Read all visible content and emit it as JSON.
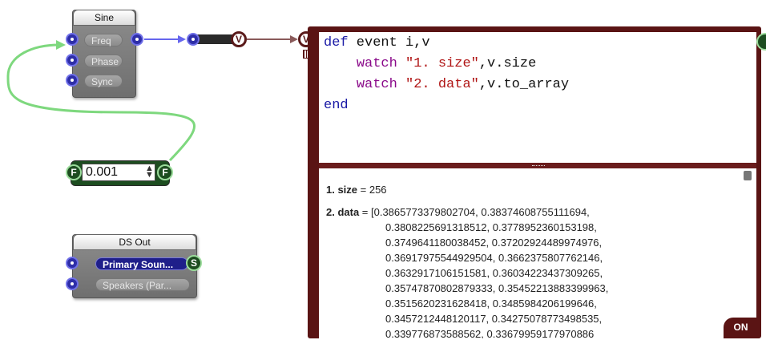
{
  "sine": {
    "title": "Sine",
    "inputs": [
      "Freq",
      "Phase",
      "Sync"
    ]
  },
  "float_box": {
    "value": "0.001",
    "in_port": "F",
    "out_port": "F"
  },
  "ds_out": {
    "title": "DS Out",
    "inputs": [
      "Primary Soun...",
      "Speakers (Par..."
    ],
    "out_port": "S"
  },
  "v_port_label": "V",
  "code": {
    "line1_def": "def",
    "line1_rest": " event i,v",
    "line2_watch": "watch",
    "line2_str": "\"1. size\"",
    "line2_rest": ",v.size",
    "line3_watch": "watch",
    "line3_str": "\"2. data\"",
    "line3_rest": ",v.to_array",
    "line4_end": "end"
  },
  "output": {
    "size_label": "1. size",
    "size_value": " = 256",
    "data_label": "2. data",
    "data_lines": [
      " = [0.3865773379802704, 0.38374608755111694,",
      "0.3808225691318512, 0.3778952360153198,",
      "0.3749641180038452, 0.37202924489974976,",
      "0.36917975544929504, 0.3662375807762146,",
      "0.3632917106151581, 0.36034223437309265,",
      "0.35747870802879333, 0.35452213883399963,",
      "0.3515620231628418, 0.3485984206199646,",
      "0.3457212448120117, 0.34275078773498535,",
      "0.339776873588562, 0.33679959177970886"
    ]
  },
  "on_button": "ON",
  "colors": {
    "ruby_frame": "#5a1414",
    "float_wire": "#7ed87e",
    "link_wire": "#6666ee",
    "v_wire": "#8a5a5a"
  }
}
